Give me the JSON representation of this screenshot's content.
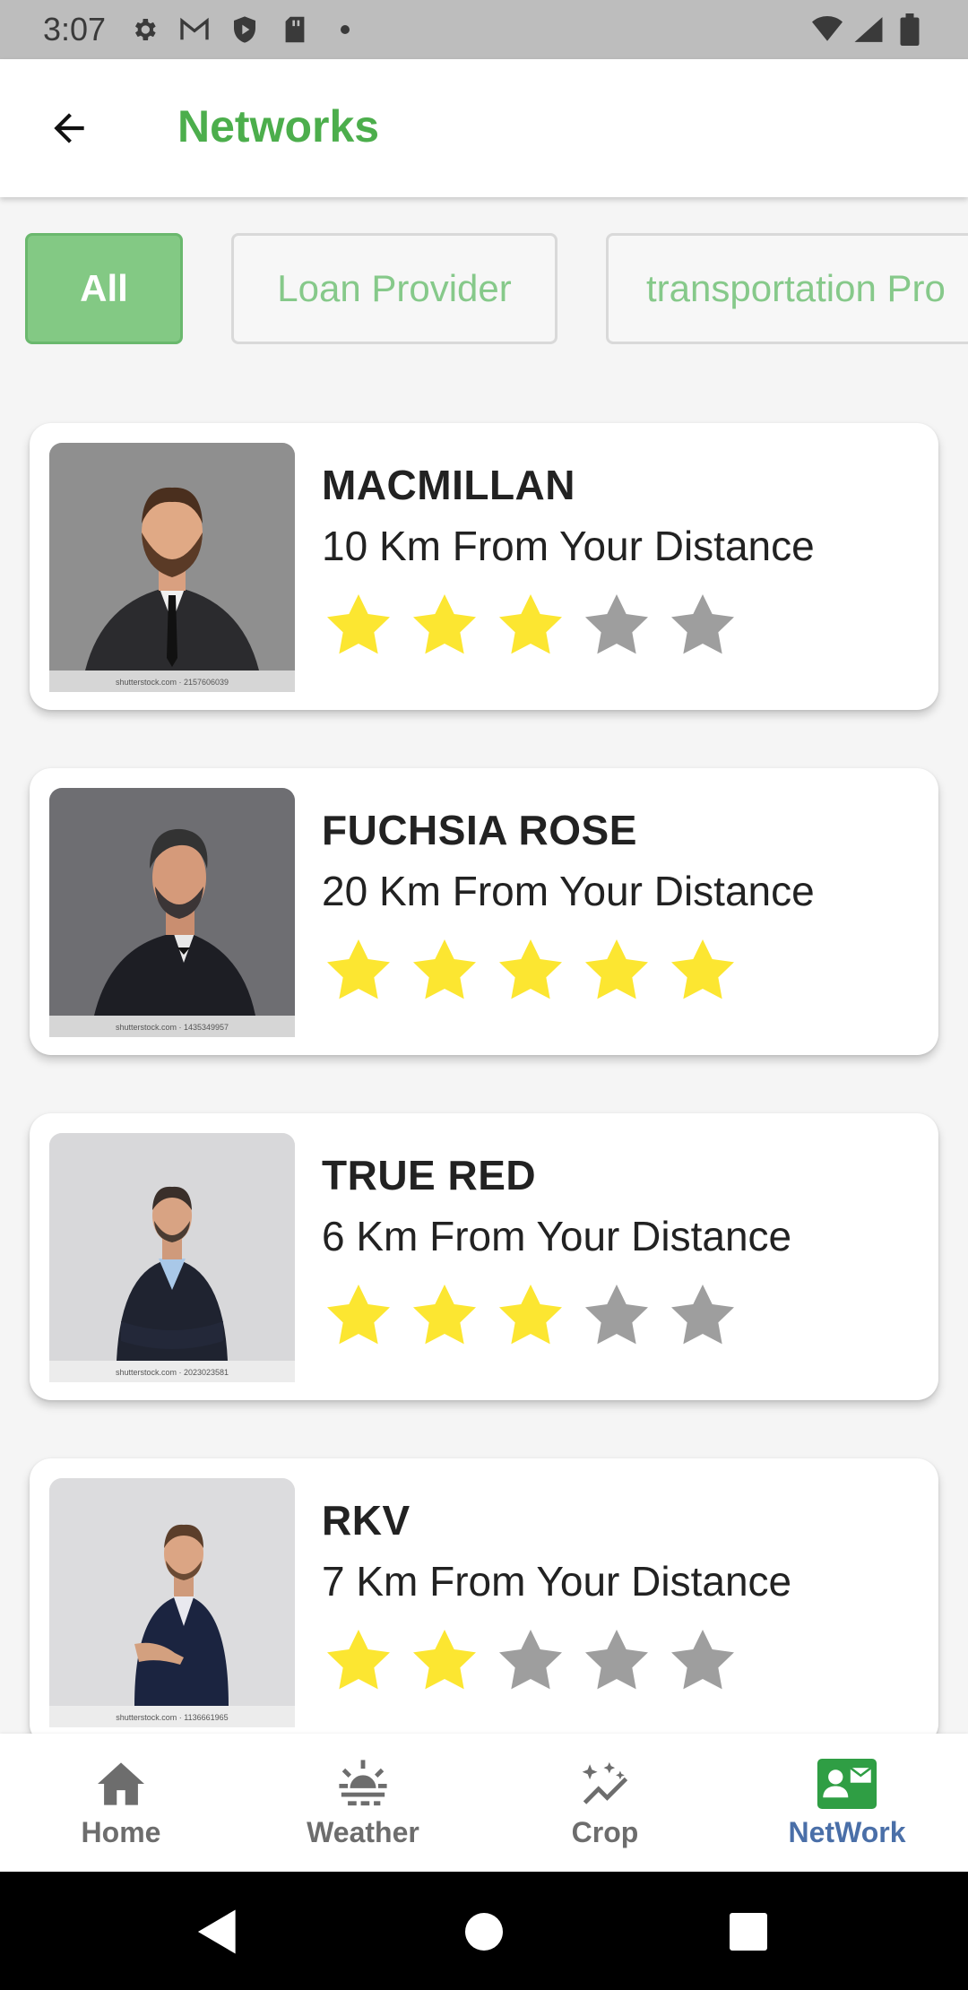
{
  "status_bar": {
    "time": "3:07",
    "icons_left": [
      "gear-icon",
      "gmail-icon",
      "shield-icon",
      "sd-card-icon",
      "dot-icon"
    ],
    "icons_right": [
      "wifi-icon",
      "signal-icon",
      "battery-icon"
    ]
  },
  "app_bar": {
    "title": "Networks",
    "title_color": "#4cae4c"
  },
  "filters": [
    {
      "label": "All",
      "active": true
    },
    {
      "label": "Loan Provider",
      "active": false
    },
    {
      "label": "transportation Pro",
      "active": false
    }
  ],
  "cards": [
    {
      "name": "MACMILLAN",
      "distance": "10 Km From Your Distance",
      "rating": 3,
      "photo_caption": "shutterstock.com · 2157606039"
    },
    {
      "name": "FUCHSIA ROSE",
      "distance": "20 Km From Your Distance",
      "rating": 5,
      "photo_caption": "shutterstock.com · 1435349957"
    },
    {
      "name": "TRUE RED",
      "distance": "6 Km From Your Distance",
      "rating": 3,
      "photo_caption": "shutterstock.com · 2023023581"
    },
    {
      "name": "RKV",
      "distance": "7 Km From Your Distance",
      "rating": 2,
      "photo_caption": "shutterstock.com · 1136661965"
    }
  ],
  "star_colors": {
    "filled": "#fce631",
    "empty": "#9e9e9e"
  },
  "bottom_nav": [
    {
      "label": "Home",
      "icon": "home-icon",
      "active": false
    },
    {
      "label": "Weather",
      "icon": "weather-icon",
      "active": false
    },
    {
      "label": "Crop",
      "icon": "crop-sparkle-icon",
      "active": false
    },
    {
      "label": "NetWork",
      "icon": "contact-card-icon",
      "active": true
    }
  ],
  "accent_active_nav": "#4a6fa8"
}
